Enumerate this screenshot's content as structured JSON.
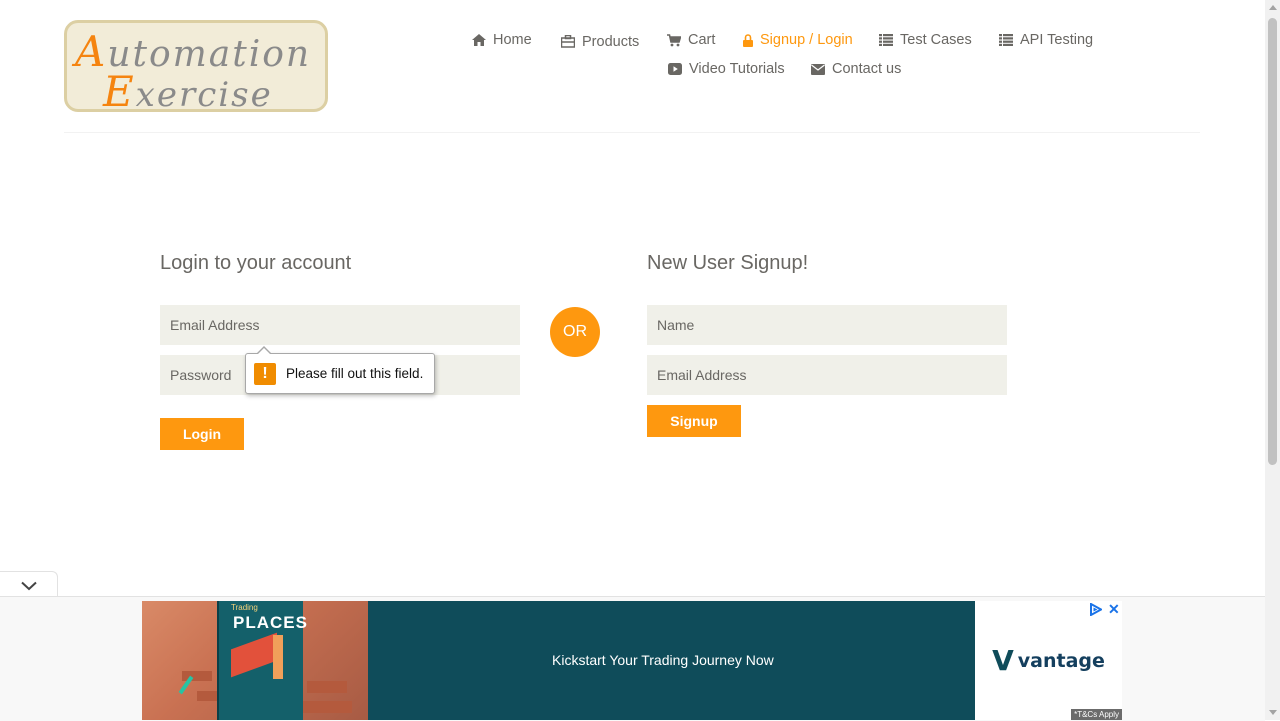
{
  "logo": {
    "cap1": "A",
    "rest1": "utomation",
    "cap2": "E",
    "rest2": "xercise"
  },
  "nav": {
    "home": "Home",
    "products": "Products",
    "cart": "Cart",
    "signup_login": "Signup / Login",
    "test_cases": "Test Cases",
    "api_testing": "API Testing",
    "video_tutorials": "Video Tutorials",
    "contact_us": "Contact us"
  },
  "login": {
    "title": "Login to your account",
    "email_placeholder": "Email Address",
    "password_placeholder": "Password",
    "button": "Login"
  },
  "or_label": "OR",
  "signup": {
    "title": "New User Signup!",
    "name_placeholder": "Name",
    "email_placeholder": "Email Address",
    "button": "Signup"
  },
  "validation_tooltip": {
    "icon": "!",
    "message": "Please fill out this field."
  },
  "ad": {
    "book_kicker": "Trading",
    "book_title": "PLACES",
    "headline": "Kickstart Your Trading Journey Now",
    "brand_mark": "V",
    "brand_name": "vantage",
    "terms": "*T&Cs Apply",
    "close": "✕"
  },
  "colors": {
    "accent": "#fe980f",
    "text": "#696763",
    "field_bg": "#f0f0e9",
    "ad_bg": "#0f4c5a"
  }
}
